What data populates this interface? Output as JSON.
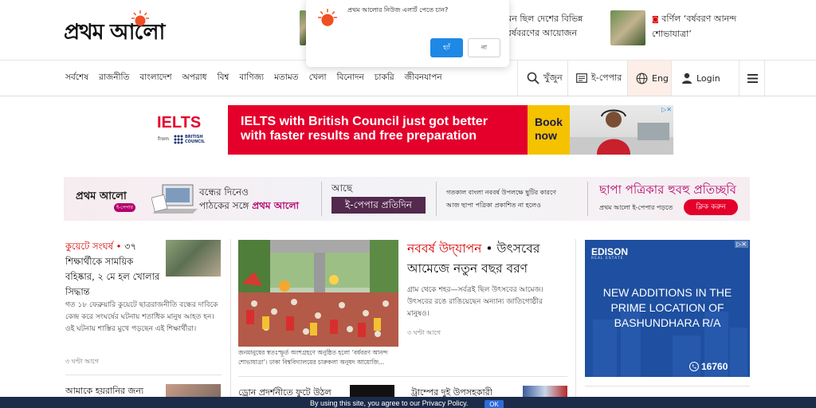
{
  "header": {
    "logo_text": "প্রথম আলো",
    "top_stories": [
      {
        "text_line1": "কেমন ছিল দেশের বিভিন্ন",
        "text_line2": "ত বর্ষবরণের আয়োজন"
      },
      {
        "text_line1": "বর্ণিল ‘বর্ষবরণ আনন্দ",
        "text_line2": "শোভাযাত্রা’"
      }
    ]
  },
  "popup": {
    "message": "প্রথম আলোর নিউজ এলার্ট পেতে চান?",
    "yes_label": "হ্যাঁ",
    "no_label": "না"
  },
  "nav": {
    "items": [
      "সর্বশেষ",
      "রাজনীতি",
      "বাংলাদেশ",
      "অপরাধ",
      "বিশ্ব",
      "বাণিজ্য",
      "মতামত",
      "খেলা",
      "বিনোদন",
      "চাকরি",
      "জীবনযাপন"
    ],
    "search_label": "খুঁজুন",
    "epaper_label": "ই-পেপার",
    "lang_label": "Eng",
    "login_label": "Login"
  },
  "ielts_ad": {
    "brand": "IELTS",
    "from": "from",
    "council_line1": "BRITISH",
    "council_line2": "COUNCIL",
    "headline_line1": "IELTS with British Council just got better",
    "headline_line2": "with faster results and free preparation",
    "cta_line1": "Book",
    "cta_line2": "now"
  },
  "epaper_banner": {
    "logo": "প্রথম আলো",
    "logo_sub": "ই-পেপার",
    "tag_line1": "বন্ধের দিনেও",
    "tag_line2_prefix": "পাঠকের সঙ্গে ",
    "tag_line2_brand": "প্রথম আলো",
    "ache": "আছে",
    "box": "ই-পেপার প্রতিদিন",
    "note_line1": "গতকাল বাংলা নববর্ষ উপলক্ষে ছুটির কারণে",
    "note_line2": "আজ ছাপা পত্রিকা প্রকাশিত না হলেও",
    "right_title": "ছাপা পত্রিকার হুবহু প্রতিচ্ছবি",
    "right_sub": "প্রথম আলো ই-পেপার পড়তে",
    "click_label": "ক্লিক করুন"
  },
  "left_story": {
    "kicker": "কুয়েটে সংঘর্ষ",
    "dot": "•",
    "title": " ৩৭ শিক্ষার্থীকে সাময়িক বহিষ্কার, ২ মে হল খোলার সিদ্ধান্ত",
    "desc": "গত ১৮ ফেব্রুয়ারি কুয়েটে ছাত্ররাজনীতি বন্ধের দাবিকে কেন্দ্র করে সংঘর্ষের ঘটনায় শতাধিক মানুষ আহত হন। ওই ঘটনায় শাস্তির মুখে পড়ছেন এই শিক্ষার্থীরা।",
    "time": "৩ ঘণ্টা আগে",
    "next_title": "আমাকে হয়রানির জন্য"
  },
  "lead_story": {
    "caption": "জনমানুষের স্বতঃস্ফূর্ত অংশগ্রহণে অনুষ্ঠিত হলো ‘বর্ষবরণ আনন্দ শোভাযাত্রা’। ঢাকা বিশ্ববিদ্যালয়ের চারুকলা অনুষদ আয়োজি...",
    "kicker": "নববর্ষ উদ্‌যাপন",
    "dot": " • ",
    "title": "উৎসবের আমেজে নতুন বছর বরণ",
    "desc": "গ্রাম থেকে শহর—সর্বত্রই ছিল উৎসবের আমেজ। উৎসবের রঙে রাঙিয়েছেন অন্যান্য জাতিগোষ্ঠীর মানুষও।",
    "time": "৩ ঘণ্টা আগে",
    "sub1_title": "ড্রোন প্রদর্শনীতে ফুটে উঠল",
    "sub2_title": "ট্রাম্পের দুই উপসহকারী"
  },
  "edison_ad": {
    "logo": "EDISON",
    "logo_sub": "REAL ESTATE",
    "line1": "NEW ADDITIONS IN THE",
    "line2": "PRIME LOCATION OF",
    "line3": "BASHUNDHARA R/A",
    "phone": "16760"
  },
  "cookie": {
    "text": "By using this site, you agree to our Privacy Policy.",
    "ok_label": "OK"
  },
  "colors": {
    "brand_red": "#d60000",
    "sun_orange": "#f04e23",
    "popup_blue": "#1e88e5",
    "epaper_purple": "#53294d",
    "edison_blue": "#1e4fa0",
    "cookie_navy": "#1c2b4a"
  }
}
